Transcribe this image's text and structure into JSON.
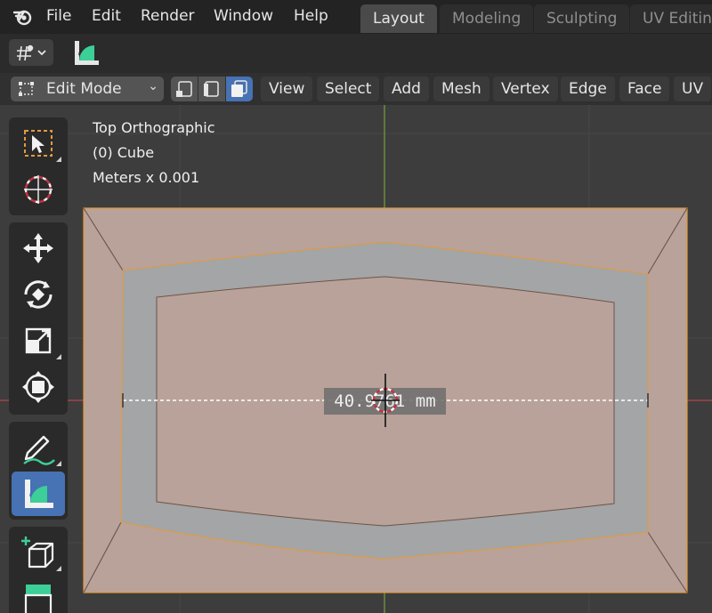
{
  "menu": {
    "items": [
      "File",
      "Edit",
      "Render",
      "Window",
      "Help"
    ]
  },
  "workspaces": {
    "tabs": [
      "Layout",
      "Modeling",
      "Sculpting",
      "UV Editing"
    ],
    "active": "Layout"
  },
  "header": {
    "mode": "Edit Mode",
    "menus": [
      "View",
      "Select",
      "Add",
      "Mesh",
      "Vertex",
      "Edge",
      "Face",
      "UV"
    ]
  },
  "viewport": {
    "view_name": "Top Orthographic",
    "object_name": "(0) Cube",
    "units": "Meters x 0.001",
    "measurement": "40.9761 mm"
  },
  "colors": {
    "accent": "#4772b3",
    "face_fill": "#b9a299",
    "selected_face": "#a3a5a6",
    "edge": "#e39b3c",
    "axis_x": "#a4434c",
    "axis_y": "#6c8b3a"
  }
}
